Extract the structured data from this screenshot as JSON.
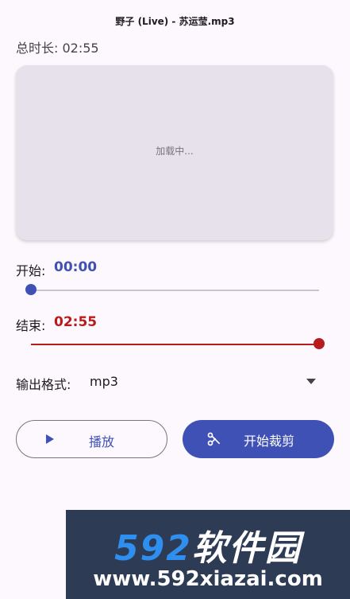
{
  "header": {
    "title": "野子 (Live) - 苏运莹.mp3"
  },
  "duration": {
    "text": "总时长: 02:55"
  },
  "waveform": {
    "loading_text": "加载中..."
  },
  "start": {
    "label": "开始:",
    "value": "00:00",
    "position_fraction": 0.0
  },
  "end": {
    "label": "结束:",
    "value": "02:55",
    "position_fraction": 1.0
  },
  "format": {
    "label": "输出格式:",
    "selected": "mp3"
  },
  "buttons": {
    "play_label": "播放",
    "cut_label": "开始裁剪"
  },
  "watermark": {
    "logo_num": "592",
    "logo_text": "软件园",
    "url": "www.592xiazai.com"
  },
  "colors": {
    "accent": "#3f51b5",
    "end_red": "#b71c1c",
    "background": "#fdf8fd"
  }
}
